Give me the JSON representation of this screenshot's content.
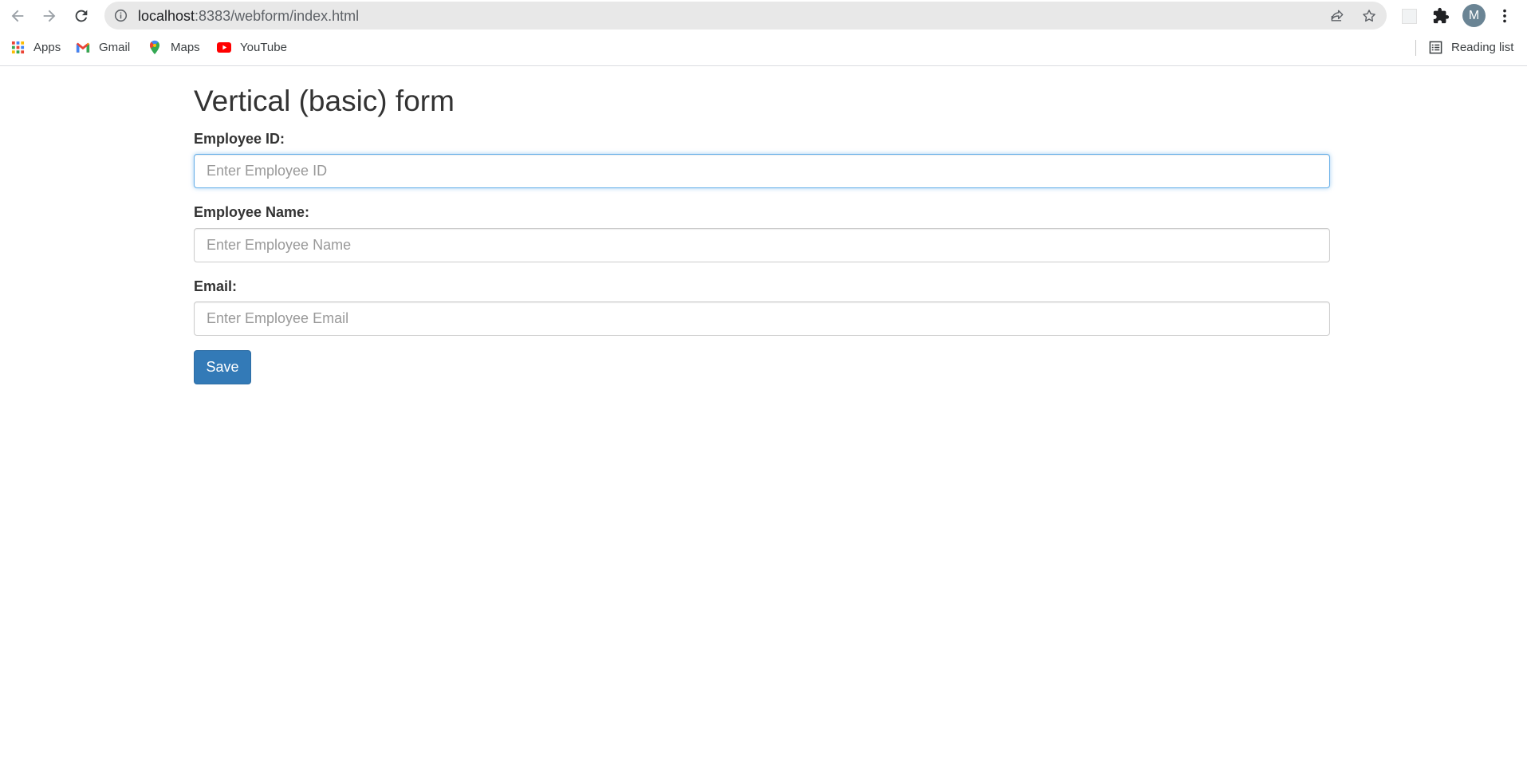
{
  "browser": {
    "url_host": "localhost",
    "url_rest": ":8383/webform/index.html",
    "avatar_letter": "M",
    "bookmarks": [
      {
        "label": "Apps"
      },
      {
        "label": "Gmail"
      },
      {
        "label": "Maps"
      },
      {
        "label": "YouTube"
      }
    ],
    "reading_list_label": "Reading list"
  },
  "form": {
    "title": "Vertical (basic) form",
    "fields": [
      {
        "label": "Employee ID:",
        "placeholder": "Enter Employee ID",
        "value": ""
      },
      {
        "label": "Employee Name:",
        "placeholder": "Enter Employee Name",
        "value": ""
      },
      {
        "label": "Email:",
        "placeholder": "Enter Employee Email",
        "value": ""
      }
    ],
    "save_label": "Save"
  },
  "colors": {
    "primary_button": "#337ab7",
    "focus_border": "#66afe9",
    "omnibox_bg": "#e8e8e8"
  }
}
